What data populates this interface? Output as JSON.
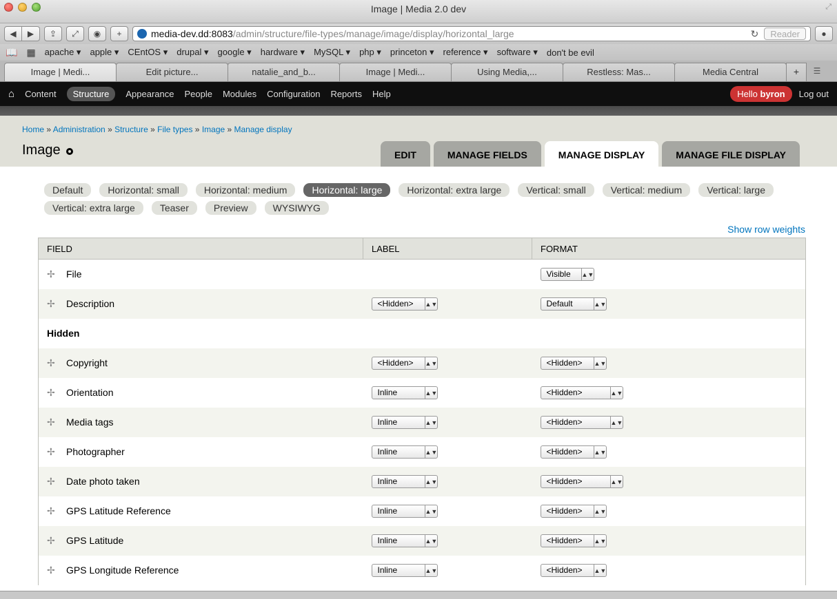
{
  "window": {
    "title": "Image | Media 2.0 dev"
  },
  "toolbar": {
    "url_host": "media-dev.dd:8083",
    "url_path": "/admin/structure/file-types/manage/image/display/horizontal_large",
    "reader_label": "Reader"
  },
  "bookmarks": [
    "apache ▾",
    "apple ▾",
    "CEntOS ▾",
    "drupal ▾",
    "google ▾",
    "hardware ▾",
    "MySQL ▾",
    "php ▾",
    "princeton ▾",
    "reference ▾",
    "software ▾",
    "don't be evil"
  ],
  "browser_tabs": [
    "Image | Medi...",
    "Edit picture...",
    "natalie_and_b...",
    "Image | Medi...",
    "Using Media,...",
    "Restless: Mas...",
    "Media Central"
  ],
  "admin": {
    "links": [
      "Content",
      "Structure",
      "Appearance",
      "People",
      "Modules",
      "Configuration",
      "Reports",
      "Help"
    ],
    "hello_prefix": "Hello ",
    "username": "byron",
    "logout": "Log out"
  },
  "breadcrumb": [
    "Home",
    "Administration",
    "Structure",
    "File types",
    "Image",
    "Manage display"
  ],
  "page_title": "Image",
  "primary_tabs": [
    "EDIT",
    "MANAGE FIELDS",
    "MANAGE DISPLAY",
    "MANAGE FILE DISPLAY"
  ],
  "view_modes": [
    "Default",
    "Horizontal: small",
    "Horizontal: medium",
    "Horizontal: large",
    "Horizontal: extra large",
    "Vertical: small",
    "Vertical: medium",
    "Vertical: large",
    "Vertical: extra large",
    "Teaser",
    "Preview",
    "WYSIWYG"
  ],
  "show_row_weights": "Show row weights",
  "table": {
    "headers": [
      "FIELD",
      "LABEL",
      "FORMAT"
    ],
    "hidden_region": "Hidden",
    "rows": [
      {
        "field": "File",
        "label": "",
        "format": "Visible"
      },
      {
        "field": "Description",
        "label": "<Hidden>",
        "format": "Default"
      },
      {
        "field": "Copyright",
        "label": "<Hidden>",
        "format": "<Hidden>"
      },
      {
        "field": "Orientation",
        "label": "Inline",
        "format": "<Hidden>"
      },
      {
        "field": "Media tags",
        "label": "Inline",
        "format": "<Hidden>"
      },
      {
        "field": "Photographer",
        "label": "Inline",
        "format": "<Hidden>"
      },
      {
        "field": "Date photo taken",
        "label": "Inline",
        "format": "<Hidden>"
      },
      {
        "field": "GPS Latitude Reference",
        "label": "Inline",
        "format": "<Hidden>"
      },
      {
        "field": "GPS Latitude",
        "label": "Inline",
        "format": "<Hidden>"
      },
      {
        "field": "GPS Longitude Reference",
        "label": "Inline",
        "format": "<Hidden>"
      }
    ]
  },
  "colors": {
    "accent_link": "#0074bd",
    "admin_bar": "#0f0f0f",
    "hello_badge": "#cc3333"
  }
}
